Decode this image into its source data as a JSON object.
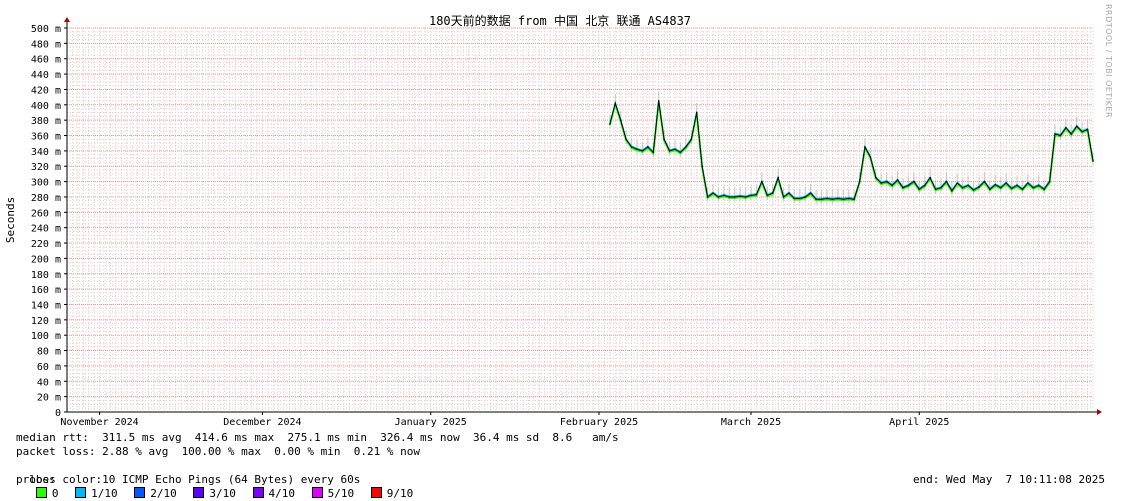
{
  "colors": {
    "background": "#ffffff",
    "grid_major": "#e8a0a0",
    "grid_minor": "#f0c8c8",
    "axis": "#000000",
    "arrow": "#aa0000",
    "median_line": "#000000",
    "smoke": "#bbbbbb"
  },
  "watermark": "RRDTOOL / TOBI OETIKER",
  "chart_data": {
    "type": "line",
    "title": "180天前的数据 from 中国 北京 联通 AS4837",
    "ylabel": "Seconds",
    "xlabel": "",
    "ylim": [
      0,
      500
    ],
    "y_unit": "ms",
    "y_ticks": [
      "0",
      "20 m",
      "40 m",
      "60 m",
      "80 m",
      "100 m",
      "120 m",
      "140 m",
      "160 m",
      "180 m",
      "200 m",
      "220 m",
      "240 m",
      "260 m",
      "280 m",
      "300 m",
      "320 m",
      "340 m",
      "360 m",
      "380 m",
      "400 m",
      "420 m",
      "440 m",
      "460 m",
      "480 m",
      "500 m"
    ],
    "x_range": [
      "2024-10-30",
      "2025-05-07"
    ],
    "x_ticks": [
      {
        "date": "2024-11-05",
        "label": "November 2024"
      },
      {
        "date": "2024-12-05",
        "label": "December 2024"
      },
      {
        "date": "2025-01-05",
        "label": "January 2025"
      },
      {
        "date": "2025-02-05",
        "label": "February 2025"
      },
      {
        "date": "2025-03-05",
        "label": "March 2025"
      },
      {
        "date": "2025-04-05",
        "label": "April 2025"
      }
    ],
    "grid": true,
    "series": [
      {
        "loss_bucket": "0",
        "x": [
          "2025-02-07",
          "2025-02-08",
          "2025-02-09",
          "2025-02-10",
          "2025-02-11",
          "2025-02-12",
          "2025-02-13",
          "2025-02-14",
          "2025-02-15",
          "2025-02-16",
          "2025-02-17",
          "2025-02-18",
          "2025-02-19",
          "2025-02-20",
          "2025-02-21",
          "2025-02-22",
          "2025-02-23",
          "2025-02-24",
          "2025-02-25",
          "2025-02-26",
          "2025-02-27",
          "2025-02-28",
          "2025-03-01",
          "2025-03-02",
          "2025-03-03",
          "2025-03-04",
          "2025-03-05",
          "2025-03-06",
          "2025-03-07",
          "2025-03-08",
          "2025-03-09",
          "2025-03-10",
          "2025-03-11",
          "2025-03-12",
          "2025-03-13",
          "2025-03-14",
          "2025-03-15",
          "2025-03-16",
          "2025-03-17",
          "2025-03-18",
          "2025-03-19",
          "2025-03-20",
          "2025-03-21",
          "2025-03-22",
          "2025-03-23",
          "2025-03-24",
          "2025-03-25",
          "2025-03-26",
          "2025-03-27",
          "2025-03-28",
          "2025-03-29",
          "2025-03-30",
          "2025-03-31",
          "2025-04-01",
          "2025-04-02",
          "2025-04-03",
          "2025-04-04",
          "2025-04-05",
          "2025-04-06",
          "2025-04-07",
          "2025-04-08",
          "2025-04-09",
          "2025-04-10",
          "2025-04-11",
          "2025-04-12",
          "2025-04-13",
          "2025-04-14",
          "2025-04-15",
          "2025-04-16",
          "2025-04-17",
          "2025-04-18",
          "2025-04-19",
          "2025-04-20",
          "2025-04-21",
          "2025-04-22",
          "2025-04-23",
          "2025-04-24",
          "2025-04-25",
          "2025-04-26",
          "2025-04-27",
          "2025-04-28",
          "2025-04-29",
          "2025-04-30",
          "2025-05-01",
          "2025-05-02",
          "2025-05-03",
          "2025-05-04",
          "2025-05-05",
          "2025-05-06",
          "2025-05-07"
        ],
        "y": [
          375,
          402,
          380,
          355,
          345,
          342,
          340,
          345,
          338,
          405,
          355,
          340,
          342,
          338,
          345,
          355,
          390,
          320,
          280,
          285,
          280,
          282,
          280,
          280,
          281,
          280,
          282,
          283,
          300,
          282,
          285,
          305,
          280,
          285,
          278,
          278,
          280,
          285,
          277,
          277,
          278,
          277,
          278,
          277,
          278,
          277,
          300,
          345,
          332,
          305,
          298,
          300,
          295,
          302,
          292,
          295,
          300,
          290,
          295,
          305,
          290,
          292,
          300,
          288,
          298,
          292,
          295,
          289,
          293,
          300,
          290,
          296,
          292,
          298,
          291,
          295,
          290,
          298,
          292,
          295,
          290,
          300,
          362,
          360,
          370,
          362,
          372,
          365,
          368,
          327
        ]
      }
    ]
  },
  "stats": {
    "median_rtt": "median rtt:  311.5 ms avg  414.6 ms max  275.1 ms min  326.4 ms now  36.4 ms sd  8.6   am/s",
    "packet_loss": "packet loss: 2.88 % avg  100.00 % max  0.00 % min  0.21 % now",
    "loss_color_label": "loss color:",
    "loss_colors": [
      {
        "label": "0",
        "color": "#26ff00"
      },
      {
        "label": "1/10",
        "color": "#00b8ff"
      },
      {
        "label": "2/10",
        "color": "#0059ff"
      },
      {
        "label": "3/10",
        "color": "#5e00ff"
      },
      {
        "label": "4/10",
        "color": "#7e00ff"
      },
      {
        "label": "5/10",
        "color": "#dd00ff"
      },
      {
        "label": "9/10",
        "color": "#ff0000"
      }
    ],
    "probe": "probe:       10 ICMP Echo Pings (64 Bytes) every 60s",
    "end": "end: Wed May  7 10:11:08 2025"
  }
}
